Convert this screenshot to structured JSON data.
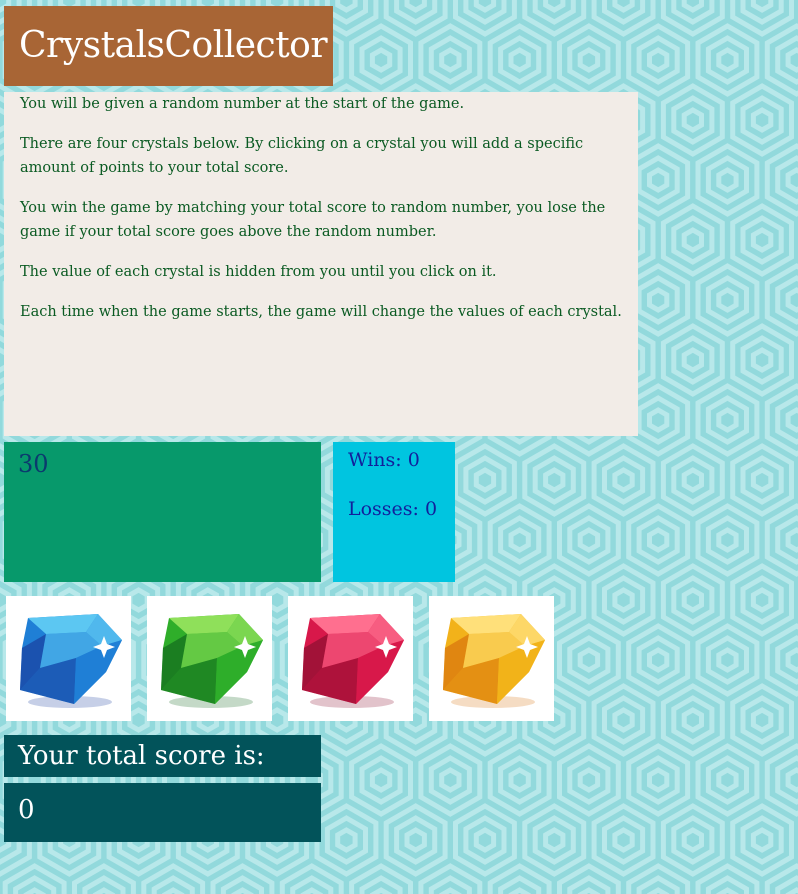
{
  "app": {
    "title": "CrystalsCollector"
  },
  "instructions": [
    "You will be given a random number at the start of the game.",
    "There are four crystals below. By clicking on a crystal you will add a specific amount of points to your total score.",
    "You win the game by matching your total score to random number, you lose the game if your total score goes above the random number.",
    "The value of each crystal is hidden from you until you click on it.",
    "Each time when the game starts, the game will change the values of each crystal."
  ],
  "game": {
    "random_number": "30",
    "wins": "Wins: 0",
    "losses": "Losses: 0",
    "score_label": "Your total score is:",
    "total_score": "0"
  },
  "crystals": [
    {
      "name": "blue-crystal",
      "icon": "blue-gem-icon",
      "color": "#1f7fd6",
      "light": "#5cc7f2",
      "dark": "#1a3f9e"
    },
    {
      "name": "green-crystal",
      "icon": "green-gem-icon",
      "color": "#2fae2a",
      "light": "#8fe05a",
      "dark": "#13691e"
    },
    {
      "name": "red-crystal",
      "icon": "red-gem-icon",
      "color": "#d8184a",
      "light": "#ff6f8f",
      "dark": "#8c0f30"
    },
    {
      "name": "yellow-crystal",
      "icon": "yellow-gem-icon",
      "color": "#f2b21a",
      "light": "#ffe07a",
      "dark": "#d9740e"
    }
  ],
  "colors": {
    "background": "#92d9dc",
    "pattern": "#b8e8ea",
    "title_bg": "#a86535",
    "instructions_bg": "#f2ece7",
    "instructions_text": "#0a5a22",
    "target_bg": "#07996b",
    "stats_bg": "#00c5e0",
    "score_bg": "#02535a"
  }
}
